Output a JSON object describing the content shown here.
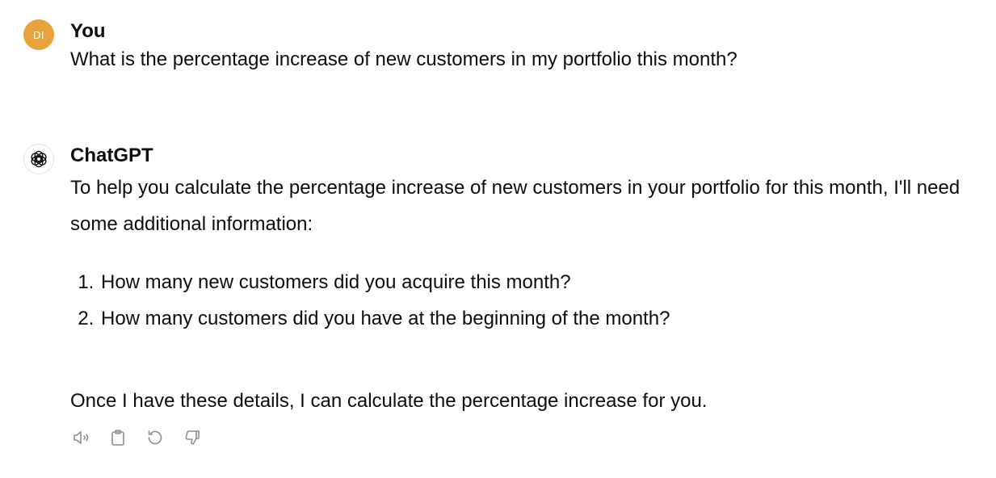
{
  "user_message": {
    "avatar_initials": "DI",
    "author": "You",
    "text": "What is the percentage increase of new customers in my portfolio this month?"
  },
  "assistant_message": {
    "author": "ChatGPT",
    "intro": "To help you calculate the percentage increase of new customers in your portfolio for this month, I'll need some additional information:",
    "questions": [
      "How many new customers did you acquire this month?",
      "How many customers did you have at the beginning of the month?"
    ],
    "closing": "Once I have these details, I can calculate the percentage increase for you."
  },
  "actions": [
    {
      "icon": "speaker-icon"
    },
    {
      "icon": "clipboard-icon"
    },
    {
      "icon": "regenerate-icon"
    },
    {
      "icon": "thumbs-down-icon"
    }
  ],
  "colors": {
    "user_avatar": "#e8a33d",
    "text": "#0d0d0d",
    "icon": "#8e8e8e"
  }
}
